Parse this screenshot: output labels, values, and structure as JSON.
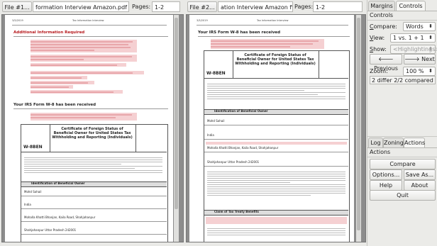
{
  "left": {
    "file_button": "File #1...",
    "file_name": "formation Interview Amazon.pdf",
    "pages_label": "Pages:",
    "pages_value": "1-2",
    "doc": {
      "date": "3/5/2019",
      "header": "Tax Information Interview",
      "section1": "Additional Information Required",
      "section2": "Your IRS Form W-8 has been received",
      "cert_title": "Certificate of Foreign Status of Beneficial Owner for United States Tax Withholding and Reporting (Individuals)",
      "form_no": "W-8BEN",
      "part1": "Identification of Beneficial Owner",
      "name": "Mohd Sohail",
      "country": "India",
      "address": "Mohalla Khatti Bhanjan, Kaila Road, Shahjahanpur",
      "city": "Shahjahanpur Uttar Pradesh 242001"
    }
  },
  "right": {
    "file_button": "File #2...",
    "file_name": "ation Interview Amazon final.pdf",
    "pages_label": "Pages:",
    "pages_value": "1-2",
    "doc": {
      "date": "3/5/2019",
      "header": "Tax Information Interview",
      "section": "Your IRS Form W-8 has been received",
      "cert_title": "Certificate of Foreign Status of Beneficial Owner for United States Tax Withholding and Reporting (Individuals)",
      "form_no": "W-8BEN",
      "part1": "Identification of Beneficial Owner",
      "name": "Mohd Sohail",
      "country": "India",
      "address": "Mohalla Khatti Bhanjan, Kaila Road, Shahjahanpur",
      "city": "Shahjahanpur Uttar Pradesh 242001",
      "part2": "Claim of Tax Treaty Benefits"
    }
  },
  "sidebar": {
    "tabs_top": [
      "Margins",
      "Controls"
    ],
    "controls_title": "Controls",
    "compare_label": "Compare:",
    "compare_value": "Words",
    "view_label": "View:",
    "view_value": "1 vs. 1 + 1",
    "show_label": "Show:",
    "show_value": "<Highlightings>",
    "previous": "Previous",
    "next": "Next",
    "zoom_label": "Zoom:",
    "zoom_value": "100 %",
    "status": "2 differ 2/2 compared",
    "tabs_bottom": [
      "Log",
      "Zoning",
      "Actions"
    ],
    "actions_title": "Actions",
    "compare_btn": "Compare",
    "options_btn": "Options...",
    "saveas_btn": "Save As...",
    "help_btn": "Help",
    "about_btn": "About",
    "quit_btn": "Quit"
  }
}
